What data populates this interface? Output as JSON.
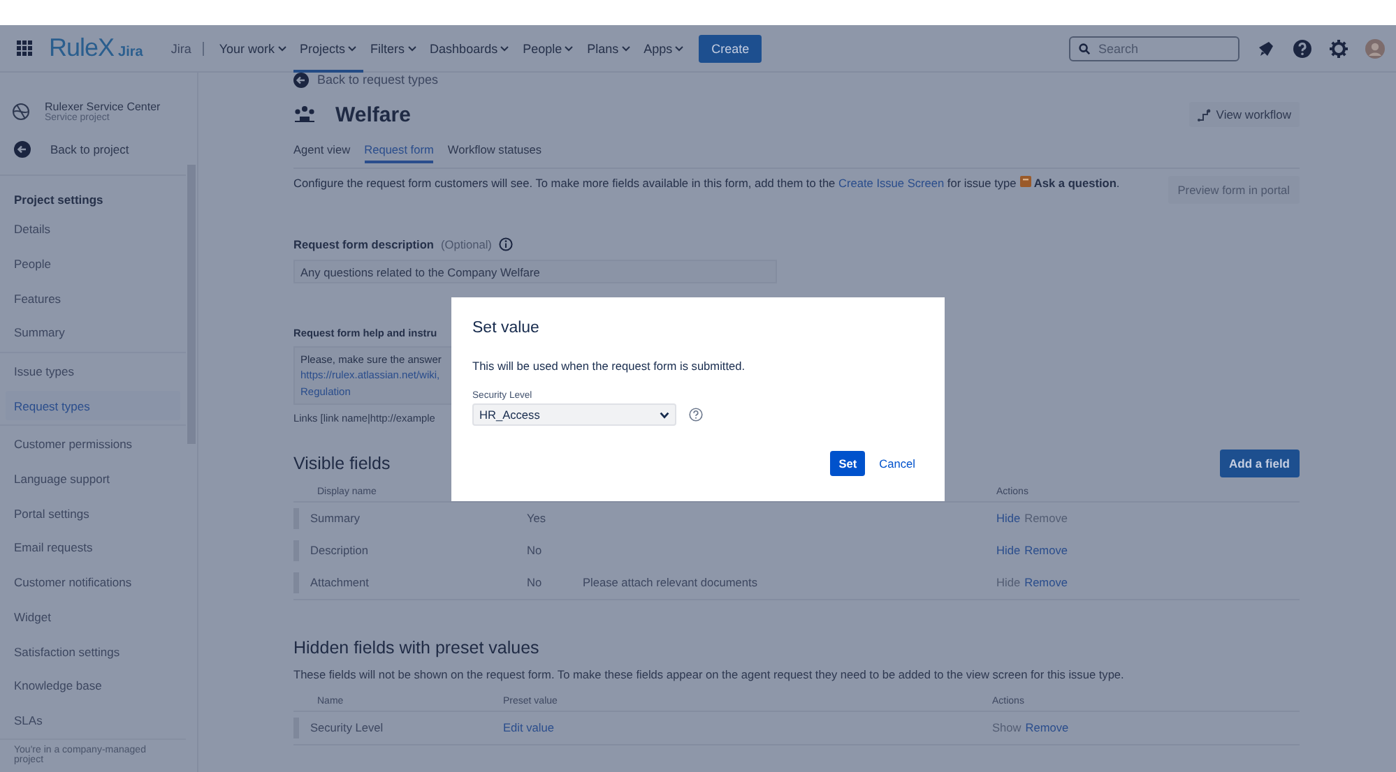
{
  "top_nav": {
    "logo": {
      "brand": "RuleX",
      "product": "Jira"
    },
    "product_link": "Jira",
    "menus": [
      {
        "label": "Your work",
        "selected": false
      },
      {
        "label": "Projects",
        "selected": true
      },
      {
        "label": "Filters",
        "selected": false
      },
      {
        "label": "Dashboards",
        "selected": false
      },
      {
        "label": "People",
        "selected": false
      },
      {
        "label": "Plans",
        "selected": false
      },
      {
        "label": "Apps",
        "selected": false
      }
    ],
    "create_button": "Create",
    "search": {
      "placeholder": "Search"
    }
  },
  "sidebar": {
    "project": {
      "name": "Rulexer Service Center",
      "type": "Service project"
    },
    "back_link": "Back to project",
    "section_title": "Project settings",
    "groups": [
      [
        {
          "label": "Details",
          "selected": false
        },
        {
          "label": "People",
          "selected": false
        },
        {
          "label": "Features",
          "selected": false
        },
        {
          "label": "Summary",
          "selected": false
        }
      ],
      [
        {
          "label": "Issue types",
          "selected": false
        },
        {
          "label": "Request types",
          "selected": true
        }
      ],
      [
        {
          "label": "Customer permissions",
          "selected": false
        },
        {
          "label": "Language support",
          "selected": false
        },
        {
          "label": "Portal settings",
          "selected": false
        },
        {
          "label": "Email requests",
          "selected": false
        },
        {
          "label": "Customer notifications",
          "selected": false
        },
        {
          "label": "Widget",
          "selected": false
        },
        {
          "label": "Satisfaction settings",
          "selected": false
        },
        {
          "label": "Knowledge base",
          "selected": false
        },
        {
          "label": "SLAs",
          "selected": false
        }
      ]
    ],
    "footer": "You're in a company-managed project"
  },
  "main": {
    "back_link": "Back to request types",
    "title": "Welfare",
    "view_workflow": "View workflow",
    "tabs": [
      {
        "label": "Agent view",
        "selected": false
      },
      {
        "label": "Request form",
        "selected": true
      },
      {
        "label": "Workflow statuses",
        "selected": false
      }
    ],
    "intro": {
      "before": "Configure the request form customers will see. To make more fields available in this form, add them to the",
      "link": "Create Issue Screen",
      "middle": "for issue type",
      "issue_type": "Ask a question",
      "after": "."
    },
    "preview_button": "Preview form in portal",
    "description": {
      "label": "Request form description",
      "optional": "(Optional)",
      "value": "Any questions related to the Company Welfare"
    },
    "help": {
      "label": "Request form help and instru",
      "text": "Please, make sure the answer",
      "link": "https://rulex.atlassian.net/wiki,",
      "link_2": "Regulation",
      "hint": "Links [link name|http://example"
    },
    "visible_fields": {
      "title": "Visible fields",
      "add_button": "Add a field",
      "columns": [
        "Display name",
        "Actions"
      ],
      "rows": [
        {
          "name": "Summary",
          "required": "Yes",
          "help": "",
          "actions": [
            {
              "label": "Hide",
              "disabled": false
            },
            {
              "label": "Remove",
              "disabled": true
            }
          ]
        },
        {
          "name": "Description",
          "required": "No",
          "help": "",
          "actions": [
            {
              "label": "Hide",
              "disabled": false
            },
            {
              "label": "Remove",
              "disabled": false
            }
          ]
        },
        {
          "name": "Attachment",
          "required": "No",
          "help": "Please attach relevant documents",
          "actions": [
            {
              "label": "Hide",
              "disabled": true
            },
            {
              "label": "Remove",
              "disabled": false
            }
          ]
        }
      ]
    },
    "hidden_fields": {
      "title": "Hidden fields with preset values",
      "description": "These fields will not be shown on the request form. To make these fields appear on the agent request they need to be added to the view screen for this issue type.",
      "columns": [
        "Name",
        "Preset value",
        "Actions"
      ],
      "rows": [
        {
          "name": "Security Level",
          "preset": "Edit value",
          "actions": [
            {
              "label": "Show",
              "disabled": true
            },
            {
              "label": "Remove",
              "disabled": false
            }
          ]
        }
      ]
    }
  },
  "dialog": {
    "title": "Set value",
    "message": "This will be used when the request form is submitted.",
    "field_label": "Security Level",
    "value": "HR_Access",
    "primary": "Set",
    "secondary": "Cancel"
  }
}
